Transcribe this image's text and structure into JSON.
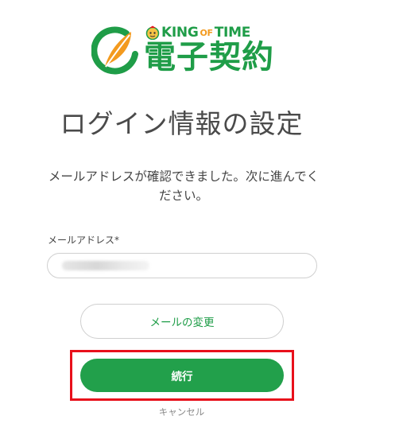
{
  "logo": {
    "brand_king": "KING",
    "brand_of": "OF",
    "brand_time": "TIME",
    "product_name": "電子契約",
    "brand_color": "#1f9d48",
    "accent_color": "#f39a1e"
  },
  "page": {
    "title": "ログイン情報の設定",
    "message": "メールアドレスが確認できました。次に進んでください。"
  },
  "form": {
    "email_label": "メールアドレス*",
    "email_value": "",
    "change_email_button": "メールの変更",
    "continue_button": "続行",
    "cancel_link": "キャンセル"
  },
  "colors": {
    "primary": "#22a04b",
    "highlight": "#e8101b"
  }
}
